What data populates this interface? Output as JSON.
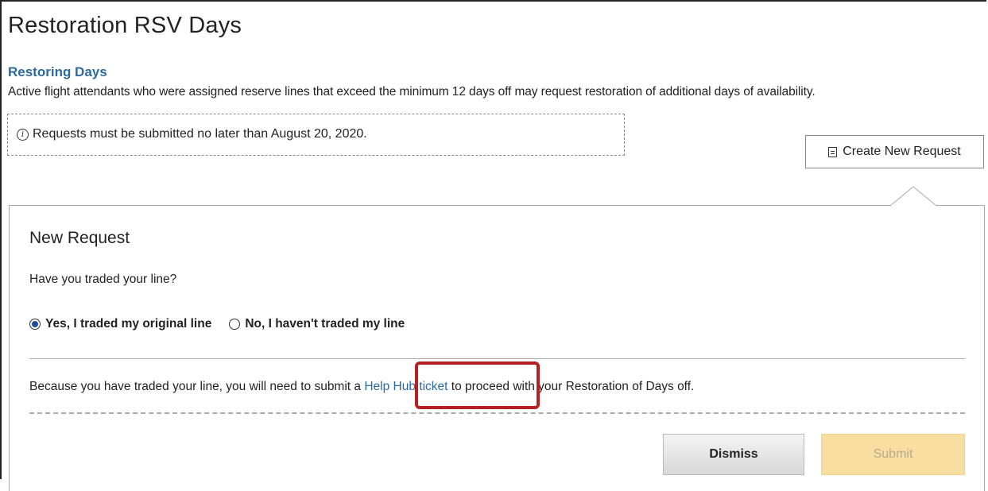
{
  "page": {
    "title": "Restoration RSV Days"
  },
  "restoring": {
    "heading": "Restoring Days",
    "description": "Active flight attendants who were assigned reserve lines that exceed the minimum 12 days off may request restoration of additional days of availability."
  },
  "notice": {
    "icon": "info-icon",
    "text": "Requests must be submitted no later than August 20, 2020."
  },
  "actions": {
    "create_label": "Create New Request",
    "create_icon": "document-icon"
  },
  "form": {
    "title": "New Request",
    "question": "Have you traded your line?",
    "options": [
      {
        "label": "Yes, I traded my original line",
        "selected": true
      },
      {
        "label": "No, I haven't traded my line",
        "selected": false
      }
    ],
    "info_before": "Because you have traded your line, you will need to submit a ",
    "link_text": "Help Hub ticket",
    "info_after": " to proceed with your Restoration of Days off.",
    "dismiss_label": "Dismiss",
    "submit_label": "Submit"
  },
  "colors": {
    "accent": "#2c6aa0",
    "highlight": "#b52020",
    "submit_bg": "#f8dea0"
  }
}
